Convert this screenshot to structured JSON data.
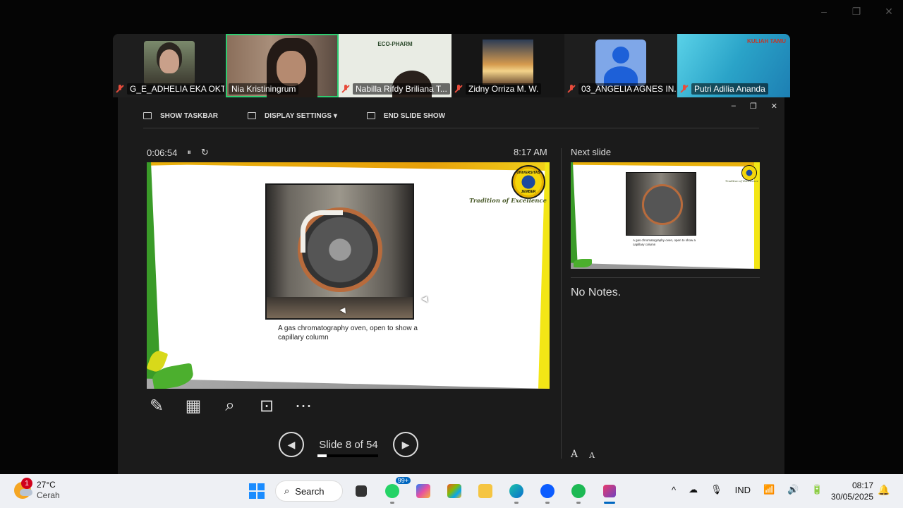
{
  "window": {
    "minimize": "–",
    "restore": "❐",
    "close": "✕"
  },
  "participants": [
    {
      "name": "G_E_ADHELIA EKA OKT...",
      "muted": true,
      "active": false
    },
    {
      "name": "Nia Kristiningrum",
      "muted": false,
      "active": true
    },
    {
      "name": "Nabilla Rifdy Briliana T...",
      "muted": true,
      "active": false,
      "bg_text": "ECO-PHARM"
    },
    {
      "name": "Zidny Orriza M. W.",
      "muted": true,
      "active": false
    },
    {
      "name": "03_ANGELIA AGNES IN...",
      "muted": true,
      "active": false
    },
    {
      "name": "Putri Adilia Ananda",
      "muted": true,
      "active": false,
      "bg_text": "KULIAH TAMU"
    }
  ],
  "presenter": {
    "window_controls": {
      "minimize": "–",
      "restore": "❐",
      "close": "✕"
    },
    "toolbar": {
      "show_taskbar": "SHOW TASKBAR",
      "display_settings": "DISPLAY SETTINGS ▾",
      "end_slide_show": "END SLIDE SHOW"
    },
    "elapsed": "0:06:54",
    "pause_icon": "⏸",
    "reset_icon": "↻",
    "clock": "8:17 AM",
    "current_slide": {
      "caption": "A gas chromatography oven, open to show a capillary column",
      "logo_top": "UNIVERSITAS",
      "logo_bottom": "JEMBER",
      "tagline": "Tradition of Excellence"
    },
    "tools": [
      "✎",
      "▦",
      "⌕",
      "⊡",
      "⋯"
    ],
    "nav": {
      "prev": "◀",
      "next": "▶",
      "counter": "Slide 8 of 54"
    },
    "progress": 0.148,
    "next_slide_label": "Next slide",
    "next_slide_caption": "A gas chromatography oven, open to show a capillary column",
    "next_slide_tagline": "Tradition of Excellence",
    "notes": "No Notes.",
    "font_larger": "A",
    "font_smaller": "A"
  },
  "taskbar": {
    "weather": {
      "temp": "27°C",
      "condition": "Cerah",
      "badge": "1"
    },
    "search_label": "Search",
    "whatsapp_badge": "99+",
    "tray": {
      "chevron": "^",
      "language": "IND"
    },
    "time": "08:17",
    "date": "30/05/2025"
  }
}
